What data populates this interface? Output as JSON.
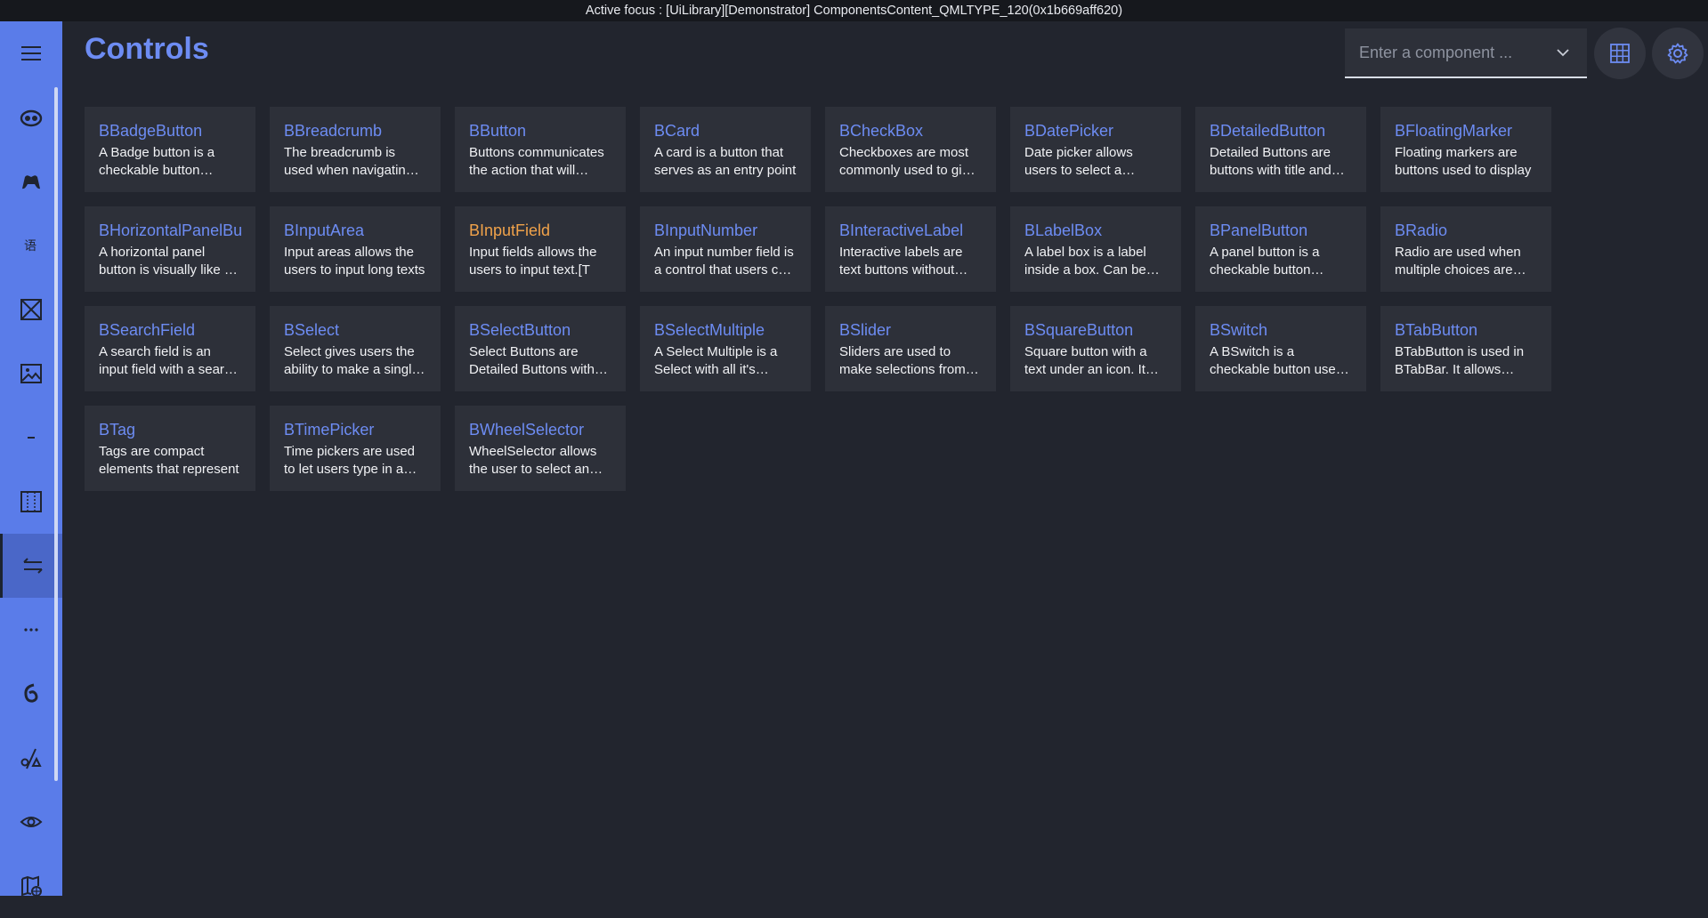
{
  "topbar": {
    "text": "Active focus : [UiLibrary][Demonstrator] ComponentsContent_QMLTYPE_120(0x1b669aff620)"
  },
  "sidebar": {
    "items": [
      {
        "icon": "menu-icon"
      },
      {
        "icon": "robot-icon"
      },
      {
        "icon": "controller-icon"
      },
      {
        "icon": "translate-icon"
      },
      {
        "icon": "placeholder-box-icon"
      },
      {
        "icon": "image-icon"
      },
      {
        "icon": "divider-icon"
      },
      {
        "icon": "layout-icon"
      },
      {
        "icon": "transfer-arrows-icon",
        "active": true
      },
      {
        "icon": "more-dots-icon"
      },
      {
        "icon": "swirl-icon"
      },
      {
        "icon": "shapes-icon"
      },
      {
        "icon": "eye-icon"
      },
      {
        "icon": "map-globe-icon"
      }
    ]
  },
  "header": {
    "title": "Controls",
    "search_placeholder": "Enter a component ...",
    "grid_view_icon": "grid-icon",
    "settings_icon": "gear-icon"
  },
  "colors": {
    "accent": "#6d8cf3",
    "focused": "#f0a24a",
    "sidebar": "#5a7ce9",
    "background": "#22252e",
    "card": "#2d3039"
  },
  "components": [
    {
      "title": "BBadgeButton",
      "desc": "A Badge button is a checkable button especially designed"
    },
    {
      "title": "BBreadcrumb",
      "desc": "The breadcrumb is used when navigating through pages"
    },
    {
      "title": "BButton",
      "desc": "Buttons communicates the action that will occur"
    },
    {
      "title": "BCard",
      "desc": "A card is a button that serves as an entry point"
    },
    {
      "title": "BCheckBox",
      "desc": "Checkboxes are most commonly used to give users"
    },
    {
      "title": "BDatePicker",
      "desc": "Date picker allows users to select a specific date"
    },
    {
      "title": "BDetailedButton",
      "desc": "Detailed Buttons are buttons with title and description"
    },
    {
      "title": "BFloatingMarker",
      "desc": "Floating markers are buttons used to display"
    },
    {
      "title": "BHorizontalPanelButton",
      "desc": "A horizontal panel button is visually like a panel"
    },
    {
      "title": "BInputArea",
      "desc": "Input areas allows the users to input long texts"
    },
    {
      "title": "BInputField",
      "desc": "Input fields allows the users to input text.[T",
      "focused": true
    },
    {
      "title": "BInputNumber",
      "desc": "An input number field is a control that users can use"
    },
    {
      "title": "BInteractiveLabel",
      "desc": "Interactive labels are text buttons without background"
    },
    {
      "title": "BLabelBox",
      "desc": "A label box is a label inside a box. Can be used"
    },
    {
      "title": "BPanelButton",
      "desc": "A panel button is a checkable button especially"
    },
    {
      "title": "BRadio",
      "desc": "Radio are used when multiple choices are available"
    },
    {
      "title": "BSearchField",
      "desc": "A search field is an input field with a search icon"
    },
    {
      "title": "BSelect",
      "desc": "Select gives users the ability to make a single choice"
    },
    {
      "title": "BSelectButton",
      "desc": "Select Buttons are Detailed Buttons with a select"
    },
    {
      "title": "BSelectMultiple",
      "desc": "A Select Multiple is a Select with all it's abilities"
    },
    {
      "title": "BSlider",
      "desc": "Sliders are used to make selections from a range"
    },
    {
      "title": "BSquareButton",
      "desc": "Square button with a text under an icon. It can"
    },
    {
      "title": "BSwitch",
      "desc": "A BSwitch is a checkable button used to toggle"
    },
    {
      "title": "BTabButton",
      "desc": "BTabButton is used in BTabBar. It allows users"
    },
    {
      "title": "BTag",
      "desc": "Tags are compact elements that represent"
    },
    {
      "title": "BTimePicker",
      "desc": "Time pickers are used to let users type in a specific time"
    },
    {
      "title": "BWheelSelector",
      "desc": "WheelSelector allows the user to select an item"
    }
  ]
}
